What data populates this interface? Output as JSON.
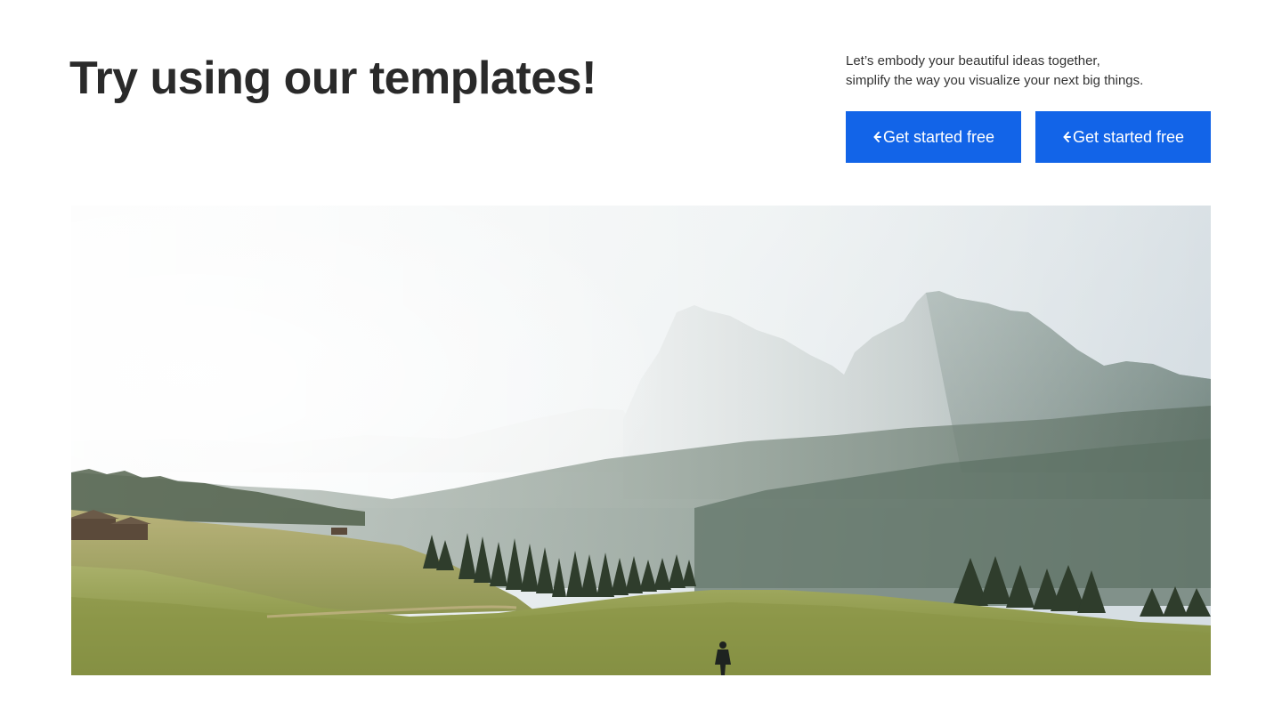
{
  "header": {
    "title": "Try using our templates!"
  },
  "intro": {
    "line1": "Let’s embody your beautiful ideas together,",
    "line2": "simplify the way you visualize your next big things."
  },
  "cta": {
    "primary_label": "Get started free",
    "secondary_label": "Get started free",
    "icon": "chevron-left-icon"
  },
  "colors": {
    "button": "#1264e8",
    "heading": "#2a2a2a"
  },
  "hero": {
    "alt": "mountain-meadow-landscape"
  }
}
